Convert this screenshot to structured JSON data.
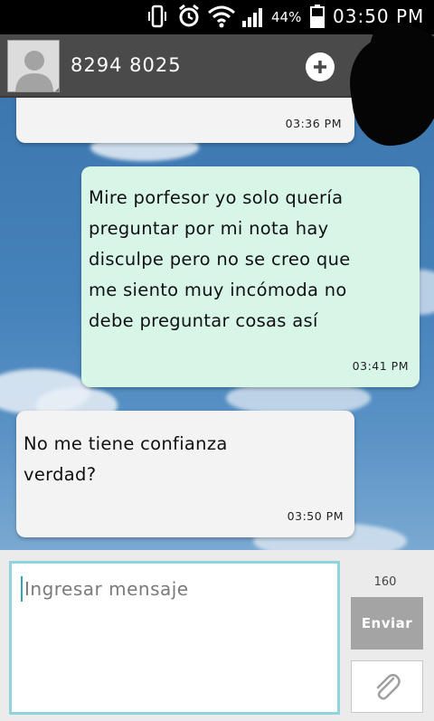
{
  "status_bar": {
    "battery_percent": "44%",
    "time": "03:50 PM",
    "icons": [
      "vibrate-icon",
      "alarm-icon",
      "wifi-icon",
      "signal-icon",
      "battery-icon"
    ]
  },
  "header": {
    "contact_name": "8294 8025",
    "avatar_icon": "default-avatar-icon",
    "add_icon": "plus-icon"
  },
  "messages": [
    {
      "direction": "incoming",
      "text": "",
      "time": "03:36 PM"
    },
    {
      "direction": "outgoing",
      "text": "Mire porfesor yo solo quería\npreguntar por mi nota hay\ndisculpe pero no se creo que\nme siento muy incómoda no\ndebe preguntar cosas así",
      "time": "03:41 PM"
    },
    {
      "direction": "incoming",
      "text": "No me tiene confianza\nverdad?",
      "time": "03:50 PM"
    }
  ],
  "composer": {
    "placeholder": "Ingresar mensaje",
    "char_count": "160",
    "send_label": "Enviar",
    "attach_icon": "paperclip-icon"
  },
  "colors": {
    "incoming_bubble": "#f3f3f3",
    "outgoing_bubble": "#d8f6e8",
    "header_bg": "#4a4a4a",
    "input_border": "#8fd3dc"
  }
}
